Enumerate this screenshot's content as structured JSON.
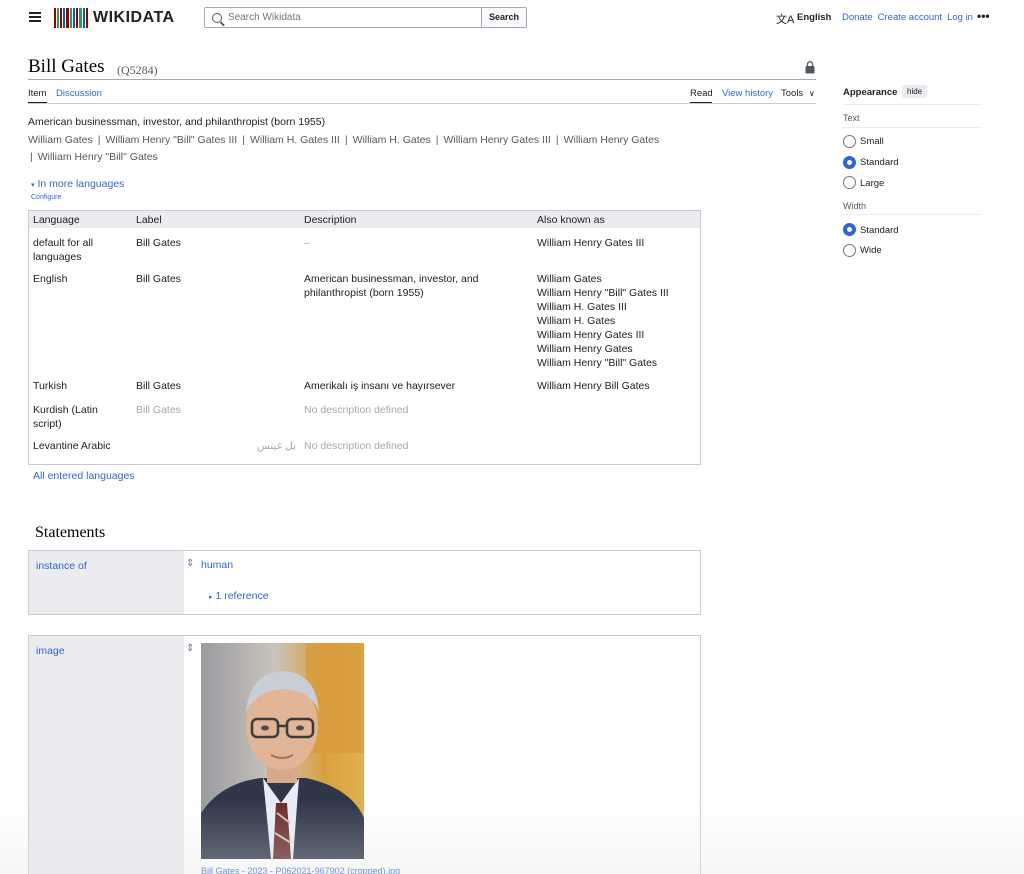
{
  "header": {
    "logo_text": "WIKIDATA",
    "search_placeholder": "Search Wikidata",
    "search_button": "Search",
    "language_icon": "translate-icon",
    "language": "English",
    "links": [
      "Donate",
      "Create account",
      "Log in"
    ],
    "more": "•••"
  },
  "page": {
    "title": "Bill Gates",
    "qid": "(Q5284)",
    "tabs": {
      "item": "Item",
      "discussion": "Discussion",
      "read": "Read",
      "history": "View history",
      "tools": "Tools"
    },
    "description": "American businessman, investor, and philanthropist (born 1955)",
    "aliases": [
      "William Gates",
      "William Henry \"Bill\" Gates III",
      "William H. Gates III",
      "William H. Gates",
      "William Henry Gates III",
      "William Henry Gates",
      "William Henry \"Bill\" Gates"
    ]
  },
  "languages": {
    "toggle": "In more languages",
    "configure": "Configure",
    "headers": [
      "Language",
      "Label",
      "Description",
      "Also known as"
    ],
    "rows": [
      {
        "language": "default for all languages",
        "label": "Bill Gates",
        "description": "–",
        "aliases": [
          "William Henry Gates III"
        ]
      },
      {
        "language": "English",
        "label": "Bill Gates",
        "description": "American businessman, investor, and philanthropist (born 1955)",
        "aliases": [
          "William Gates",
          "William Henry \"Bill\" Gates III",
          "William H. Gates III",
          "William H. Gates",
          "William Henry Gates III",
          "William Henry Gates",
          "William Henry \"Bill\" Gates"
        ]
      },
      {
        "language": "Turkish",
        "label": "Bill Gates",
        "description": "Amerikalı iş insanı ve hayırsever",
        "aliases": [
          "William Henry Bill Gates"
        ]
      },
      {
        "language": "Kurdish (Latin script)",
        "label": "Bill Gates",
        "description": "No description defined",
        "aliases": []
      },
      {
        "language": "Levantine Arabic",
        "label": "بل غيتس",
        "description": "No description defined",
        "aliases": []
      }
    ],
    "all_link": "All entered languages"
  },
  "statements": {
    "heading": "Statements",
    "items": [
      {
        "property": "instance of",
        "value": "human",
        "references": "1 reference"
      },
      {
        "property": "image",
        "caption": "Bill Gates - 2023 - P062021-967902 (cropped).jpg"
      }
    ]
  },
  "appearance": {
    "title": "Appearance",
    "hide": "hide",
    "text_label": "Text",
    "text_options": [
      "Small",
      "Standard",
      "Large"
    ],
    "text_selected": "Standard",
    "width_label": "Width",
    "width_options": [
      "Standard",
      "Wide"
    ],
    "width_selected": "Standard"
  },
  "colors": {
    "link": "#3366cc",
    "header_bg": "#eaecf0",
    "border": "#c8ccd1"
  }
}
